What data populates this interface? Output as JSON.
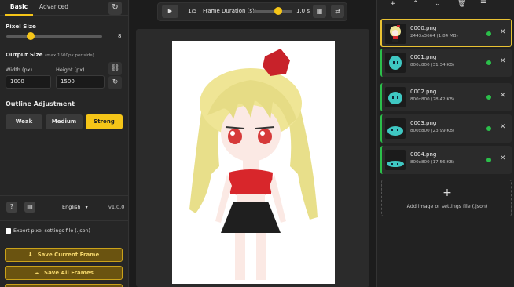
{
  "tabs": {
    "basic": "Basic",
    "advanced": "Advanced"
  },
  "pixel_size": {
    "label": "Pixel Size",
    "value": "8",
    "level": 0.2
  },
  "output_size": {
    "label": "Output Size",
    "hint": "(max 1500px per side)",
    "width_label": "Width (px)",
    "width_value": "1000",
    "height_label": "Height (px)",
    "height_value": "1500"
  },
  "outline": {
    "label": "Outline Adjustment",
    "options": [
      "Weak",
      "Medium",
      "Strong"
    ],
    "selected": "Strong"
  },
  "footer": {
    "language": "English",
    "version": "v1.0.0"
  },
  "export_settings_label": "Export pixel settings file (.json)",
  "actions": {
    "save_current": "Save Current Frame",
    "save_all": "Save All Frames"
  },
  "player": {
    "frame_counter": "1/5",
    "duration_label": "Frame Duration (s):",
    "duration_value": "1.0 s",
    "duration_level": 0.55
  },
  "frames": [
    {
      "name": "0000.png",
      "meta": "2443x3664 (1.84 MB)",
      "selected": true
    },
    {
      "name": "0001.png",
      "meta": "800x800 (31.34 KB)",
      "selected": false
    },
    {
      "name": "0002.png",
      "meta": "800x800 (28.42 KB)",
      "selected": false
    },
    {
      "name": "0003.png",
      "meta": "800x800 (23.99 KB)",
      "selected": false
    },
    {
      "name": "0004.png",
      "meta": "800x800 (17.56 KB)",
      "selected": false
    }
  ],
  "add_box": {
    "text": "Add image or settings file (.json)"
  },
  "colors": {
    "accent": "#f5c518",
    "status": "#2bbf4a",
    "bg": "#1e1e1e"
  }
}
